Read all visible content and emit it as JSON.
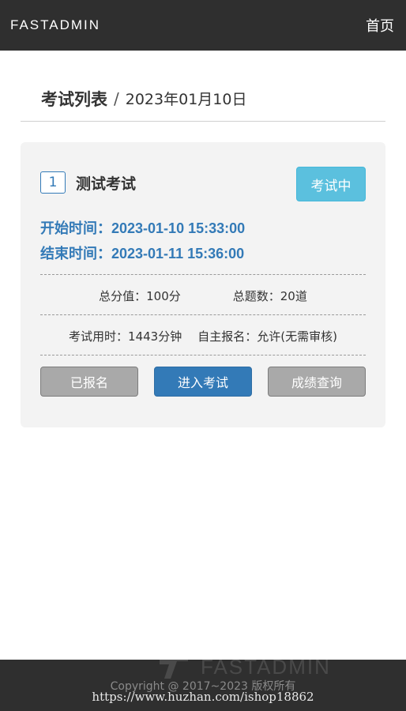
{
  "navbar": {
    "brand": "FASTADMIN",
    "home_label": "首页"
  },
  "header": {
    "title": "考试列表",
    "separator": "/",
    "date": "2023年01月10日"
  },
  "exam": {
    "index": "1",
    "name": "测试考试",
    "status_label": "考试中",
    "start_time": "开始时间：2023-01-10 15:33:00",
    "end_time": "结束时间：2023-01-11 15:36:00",
    "total_score": "总分值：100分",
    "total_questions": "总题数：20道",
    "duration": "考试用时：1443分钟",
    "self_register": "自主报名：允许(无需审核)",
    "buttons": {
      "registered": "已报名",
      "enter": "进入考试",
      "results": "成绩查询"
    }
  },
  "footer": {
    "logo_text": "FASTADMIN",
    "copyright": "Copyright @ 2017~2023 版权所有",
    "watermark": "https://www.huzhan.com/ishop18862"
  },
  "colors": {
    "navbar_bg": "#2f2f2f",
    "primary": "#337ab7",
    "info": "#5bc0de",
    "button_gray": "#a9a9a9",
    "card_bg": "#f3f3f3"
  }
}
